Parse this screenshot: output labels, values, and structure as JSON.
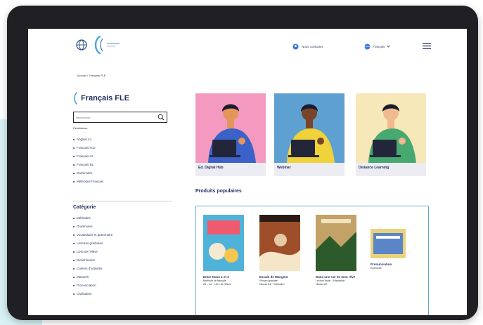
{
  "header": {
    "link_label": "Nous contacter",
    "lang_label": "Français",
    "colors": {
      "navy": "#1e2b5c",
      "accent": "#6aaed6",
      "bg_accent": "#d6f0f3"
    }
  },
  "breadcrumb": {
    "text": "Accueil › Français FLE"
  },
  "sidebar": {
    "title": "Français FLE",
    "search": {
      "value": "",
      "placeholder": "Rechercher"
    },
    "small_text": "Réinitialiser",
    "levels": [
      "Anglais A1",
      "Français FLE",
      "Français A2",
      "Français B1",
      "Grammaire",
      "Méthodes Français"
    ],
    "categories_title": "Catégorie",
    "categories": [
      "Méthodes",
      "Grammaire",
      "Vocabulaire et grammaire",
      "Lectures graduées",
      "Livre de l'élève",
      "Dictionnaires",
      "Cahiers d'activités",
      "Manuels",
      "Prononciation",
      "Civilisation"
    ]
  },
  "cards": [
    {
      "label": "Ed. Digital Hub",
      "bg": "#f49ac0",
      "shirt": "#3a62c9",
      "skin": "#e4955b"
    },
    {
      "label": "Webinar",
      "bg": "#5fa0d2",
      "shirt": "#f0d33a",
      "skin": "#7a4428"
    },
    {
      "label": "Distance Learning",
      "bg": "#f6e8b8",
      "shirt": "#48a970",
      "skin": "#f0b98f"
    }
  ],
  "section": {
    "title": "Produits populaires"
  },
  "products": [
    {
      "title": "Entre Nous 1 et 2",
      "subtitle": "Méthode de français",
      "details": "A1 – A2 · Livre de l'élève",
      "cover_bg": "#4fb3d9",
      "cover_accent": "#ef5a6f"
    },
    {
      "title": "Escale de Mangeur",
      "subtitle": "Roman graduée",
      "details": "Niveau B1 · Collection",
      "cover_bg": "#9e4f2a",
      "cover_accent": "#f6e6c8"
    },
    {
      "title": "Dans une rue de mon rêve",
      "subtitle": "Lecture facile · Adaptation",
      "details": "Niveau A2",
      "cover_bg": "#c2a266",
      "cover_accent": "#2d5a2a"
    },
    {
      "title": "Pronunciation",
      "subtitle": "Exercices",
      "details": "",
      "cover_bg": "#e9d27a",
      "cover_accent": "#5a85c7"
    }
  ]
}
